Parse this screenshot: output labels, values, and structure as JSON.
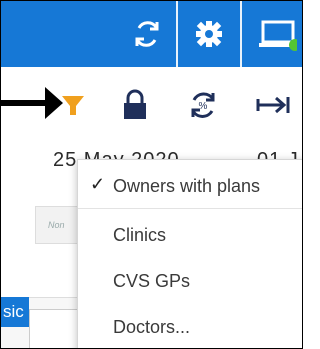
{
  "top_bar": {
    "color": "#1678d6",
    "buttons": [
      {
        "icon": "sync-icon"
      },
      {
        "icon": "gear-icon"
      },
      {
        "icon": "monitor-icon",
        "status_dot": "#55c533"
      }
    ]
  },
  "toolbar": {
    "icons": [
      "filter-icon",
      "lock-icon",
      "percent-refresh-icon",
      "arrow-transfer-icon"
    ],
    "filter_color": "#f0a01e",
    "icon_color": "#1f2f5a"
  },
  "dates": {
    "start": "25 May 2020",
    "end": "01 J"
  },
  "background": {
    "pill_text": "Non",
    "tab_text": "sic"
  },
  "filter_menu": {
    "items": [
      {
        "label": "Owners with plans",
        "checked": true
      },
      {
        "label": "Clinics",
        "checked": false
      },
      {
        "label": "CVS GPs",
        "checked": false
      },
      {
        "label": "Doctors...",
        "checked": false
      }
    ],
    "check_glyph": "✓"
  }
}
